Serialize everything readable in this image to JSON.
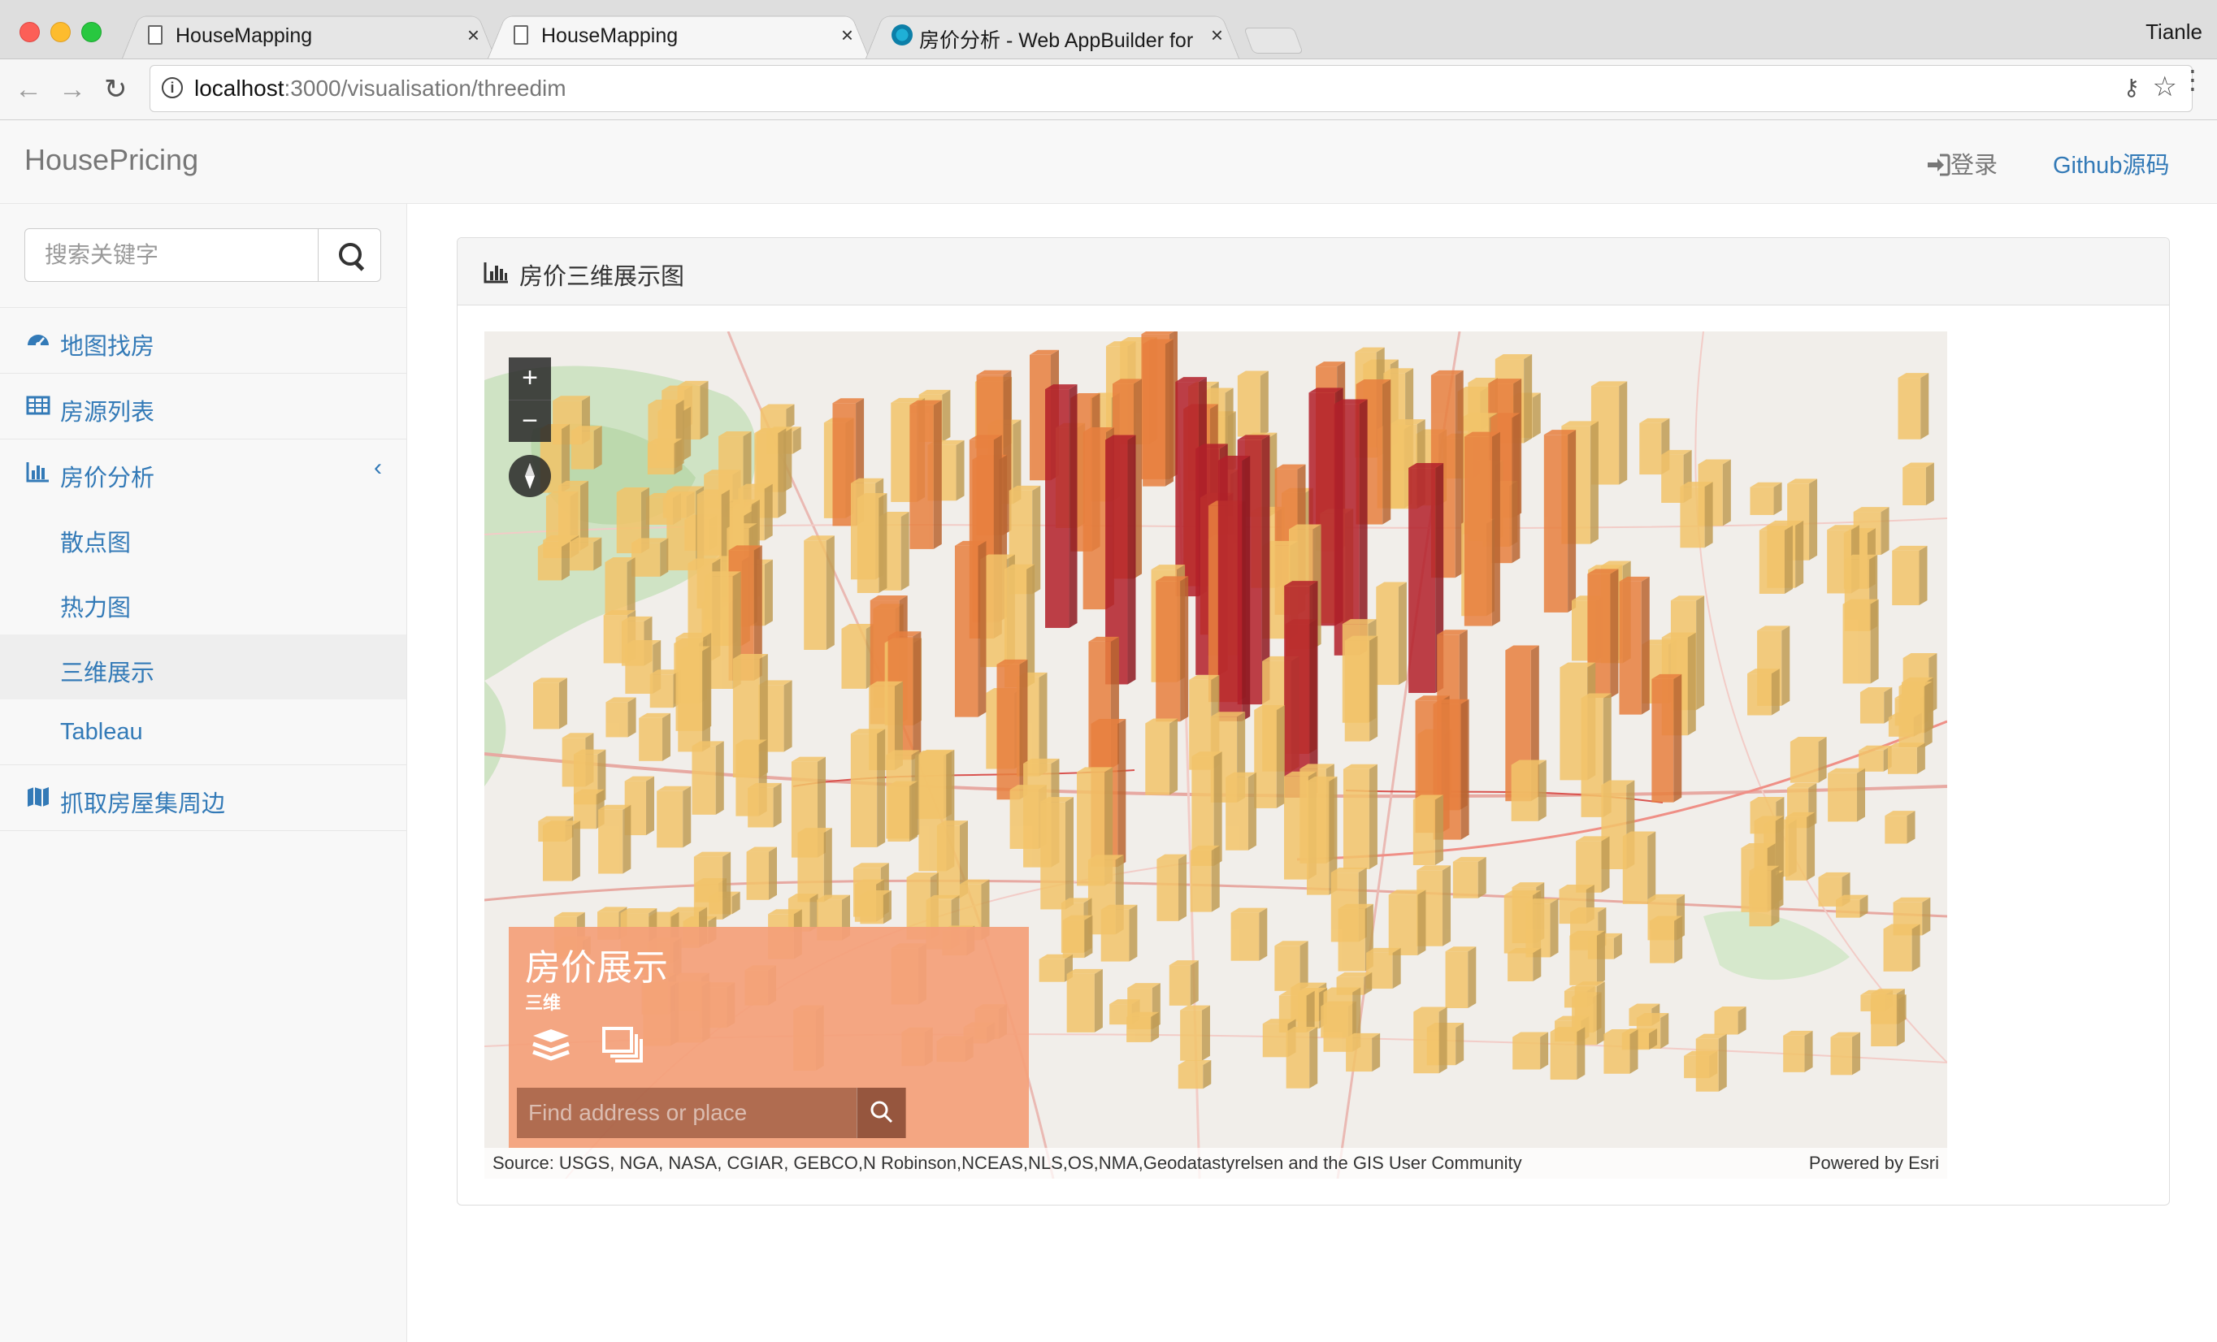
{
  "browser": {
    "tabs": [
      {
        "label": "HouseMapping"
      },
      {
        "label": "HouseMapping"
      },
      {
        "label": "房价分析 - Web AppBuilder for"
      }
    ],
    "user": "Tianle",
    "url_host": "localhost",
    "url_path": ":3000/visualisation/threedim"
  },
  "header": {
    "brand": "HousePricing",
    "login": "登录",
    "github": "Github源码"
  },
  "sidebar": {
    "search_placeholder": "搜索关键字",
    "items": [
      {
        "label": "地图找房",
        "icon": "dashboard-icon"
      },
      {
        "label": "房源列表",
        "icon": "table-icon"
      },
      {
        "label": "房价分析",
        "icon": "bar-chart-icon",
        "expanded": true,
        "children": [
          {
            "label": "散点图"
          },
          {
            "label": "热力图"
          },
          {
            "label": "三维展示",
            "active": true
          },
          {
            "label": "Tableau"
          }
        ]
      },
      {
        "label": "抓取房屋集周边",
        "icon": "map-icon"
      }
    ]
  },
  "panel": {
    "title": "房价三维展示图",
    "icon": "bar-chart-icon"
  },
  "map": {
    "attribution": "Source: USGS, NGA, NASA, CGIAR, GEBCO,N Robinson,NCEAS,NLS,OS,NMA,Geodatastyrelsen and the GIS User Community",
    "powered_by": "Powered by Esri",
    "widget": {
      "title": "房价展示",
      "subtitle": "三维",
      "search_placeholder": "Find address or place"
    },
    "colors": {
      "high": "#b3202a",
      "mid": "#e8803f",
      "low": "#f3c46a",
      "widget": "#f4a078"
    }
  }
}
